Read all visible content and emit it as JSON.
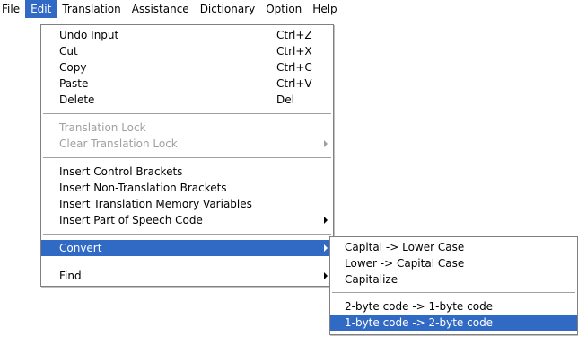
{
  "menubar": {
    "items": [
      {
        "label": "File"
      },
      {
        "label": "Edit"
      },
      {
        "label": "Translation"
      },
      {
        "label": "Assistance"
      },
      {
        "label": "Dictionary"
      },
      {
        "label": "Option"
      },
      {
        "label": "Help"
      }
    ]
  },
  "edit_menu": {
    "undo": {
      "label": "Undo Input",
      "accel": "Ctrl+Z"
    },
    "cut": {
      "label": "Cut",
      "accel": "Ctrl+X"
    },
    "copy": {
      "label": "Copy",
      "accel": "Ctrl+C"
    },
    "paste": {
      "label": "Paste",
      "accel": "Ctrl+V"
    },
    "delete": {
      "label": "Delete",
      "accel": "Del"
    },
    "translation_lock": {
      "label": "Translation Lock"
    },
    "clear_translation_lock": {
      "label": "Clear Translation Lock"
    },
    "insert_control_brackets": {
      "label": "Insert Control Brackets"
    },
    "insert_non_translation_brackets": {
      "label": "Insert Non-Translation Brackets"
    },
    "insert_tm_variables": {
      "label": "Insert Translation Memory Variables"
    },
    "insert_pos_code": {
      "label": "Insert Part of Speech Code"
    },
    "convert": {
      "label": "Convert"
    },
    "find": {
      "label": "Find"
    }
  },
  "convert_submenu": {
    "capital_to_lower": {
      "label": "Capital -> Lower Case"
    },
    "lower_to_capital": {
      "label": "Lower -> Capital Case"
    },
    "capitalize": {
      "label": "Capitalize"
    },
    "two_to_one": {
      "label": "2-byte code -> 1-byte code"
    },
    "one_to_two": {
      "label": "1-byte code -> 2-byte code"
    }
  },
  "colors": {
    "highlight": "#316ac5",
    "disabled_text": "#a0a0a0",
    "menu_border": "#808080"
  }
}
